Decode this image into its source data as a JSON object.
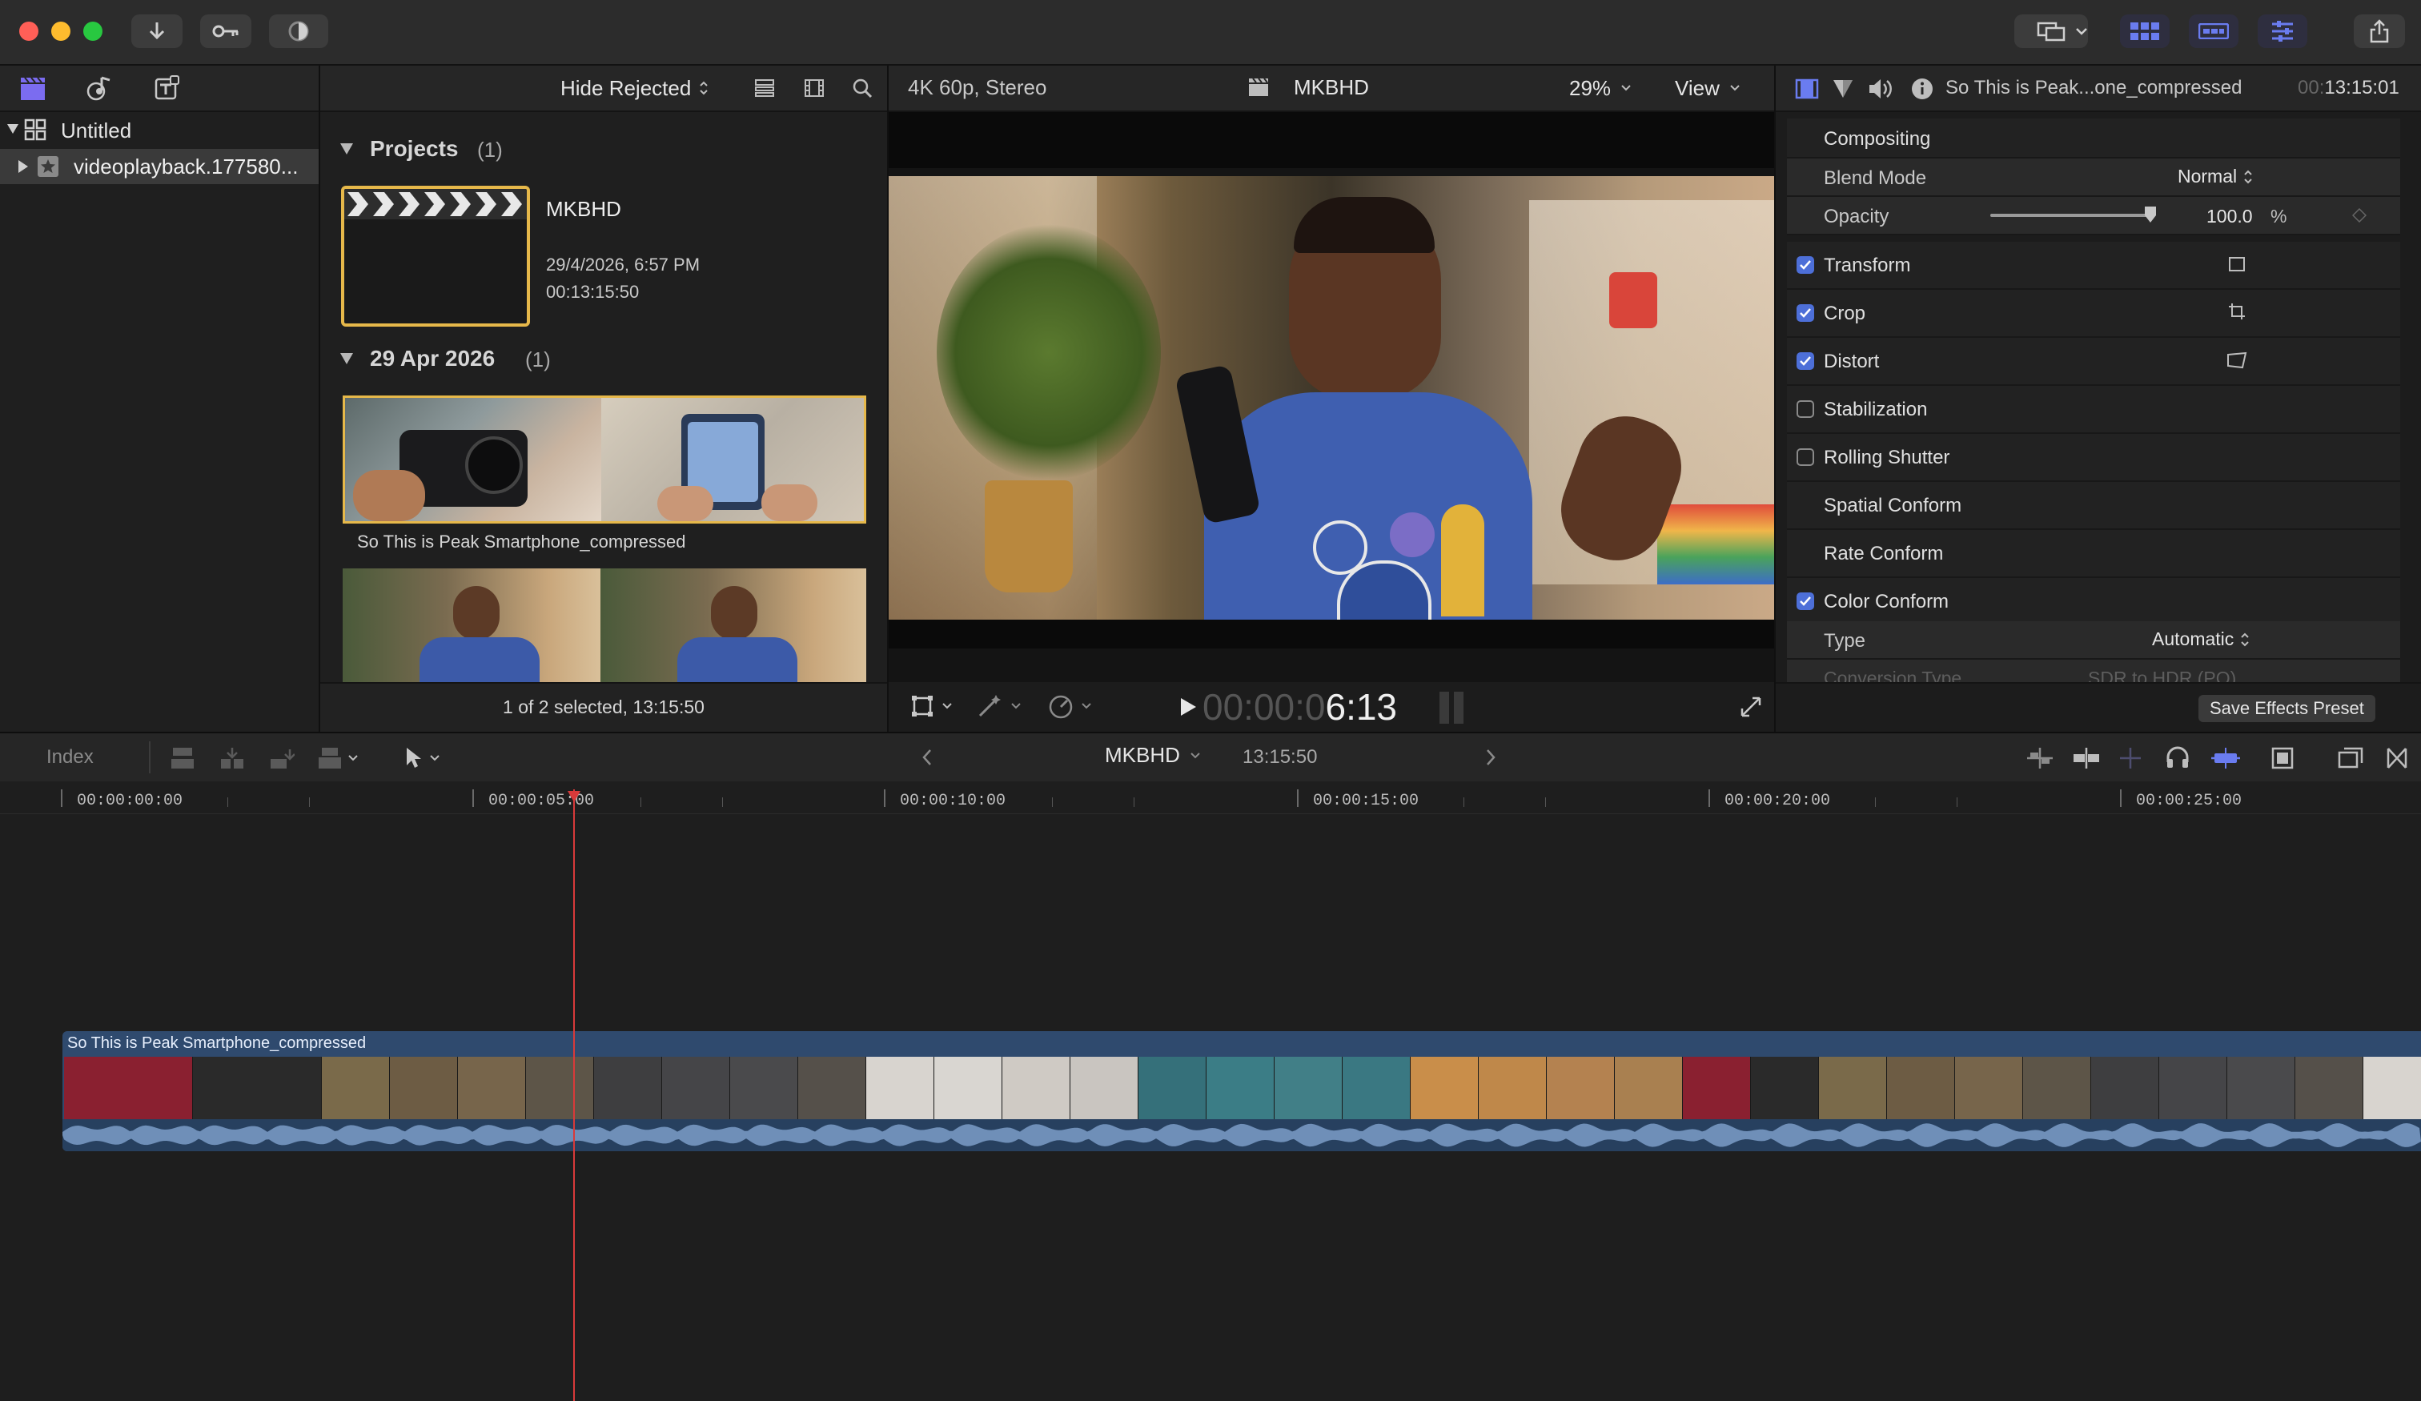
{
  "toolbar": {
    "icons": [
      "import-icon",
      "keywords-icon",
      "background-tasks-icon",
      "second-display-icon",
      "chevron-down-icon",
      "libraries-grid-icon",
      "timeline-layout-icon",
      "inspector-icon",
      "share-icon"
    ]
  },
  "sidebar": {
    "library_name": "Untitled",
    "event_name": "videoplayback.177580..."
  },
  "browser": {
    "filter": "Hide Rejected",
    "projects_heading": "Projects",
    "projects_count": "(1)",
    "project": {
      "name": "MKBHD",
      "date": "29/4/2026, 6:57 PM",
      "duration": "00:13:15:50"
    },
    "date_heading": "29 Apr 2026",
    "date_count": "(1)",
    "clip_name": "So This is Peak Smartphone_compressed",
    "status": "1 of 2 selected, 13:15:50"
  },
  "viewer": {
    "format": "4K 60p, Stereo",
    "project_name": "MKBHD",
    "zoom": "29%",
    "view_label": "View",
    "timecode_dim": "00:00:0",
    "timecode_bright": "6:13"
  },
  "inspector": {
    "clip_title": "So This is Peak...one_compressed",
    "timecode_prefix": "00:",
    "timecode": "13:15:01",
    "compositing": "Compositing",
    "blend_mode_label": "Blend Mode",
    "blend_mode_value": "Normal",
    "opacity_label": "Opacity",
    "opacity_value": "100.0",
    "opacity_unit": "%",
    "opacity_level": 1.0,
    "transform": "Transform",
    "crop": "Crop",
    "distort": "Distort",
    "stabilization": "Stabilization",
    "rolling_shutter": "Rolling Shutter",
    "spatial_conform": "Spatial Conform",
    "rate_conform": "Rate Conform",
    "color_conform": "Color Conform",
    "type_label": "Type",
    "type_value": "Automatic",
    "conversion_label": "Conversion Type",
    "conversion_value": "SDR to HDR (PQ)",
    "save_preset": "Save Effects Preset",
    "checks": {
      "transform": true,
      "crop": true,
      "distort": true,
      "stabilization": false,
      "rolling_shutter": false,
      "color_conform": true
    }
  },
  "timeline": {
    "index_label": "Index",
    "project_name": "MKBHD",
    "duration": "13:15:50",
    "ruler": [
      "00:00:00:00",
      "00:00:05:00",
      "00:00:10:00",
      "00:00:15:00",
      "00:00:20:00",
      "00:00:25:00"
    ],
    "clip_name": "So This is Peak Smartphone_compressed"
  },
  "colors": {
    "accent": "#4d6fd8",
    "playhead": "#d83a3a",
    "selection": "#e6b84a",
    "clip_blue": "#2f4a6e",
    "audio_wave": "#6f8fb8"
  }
}
